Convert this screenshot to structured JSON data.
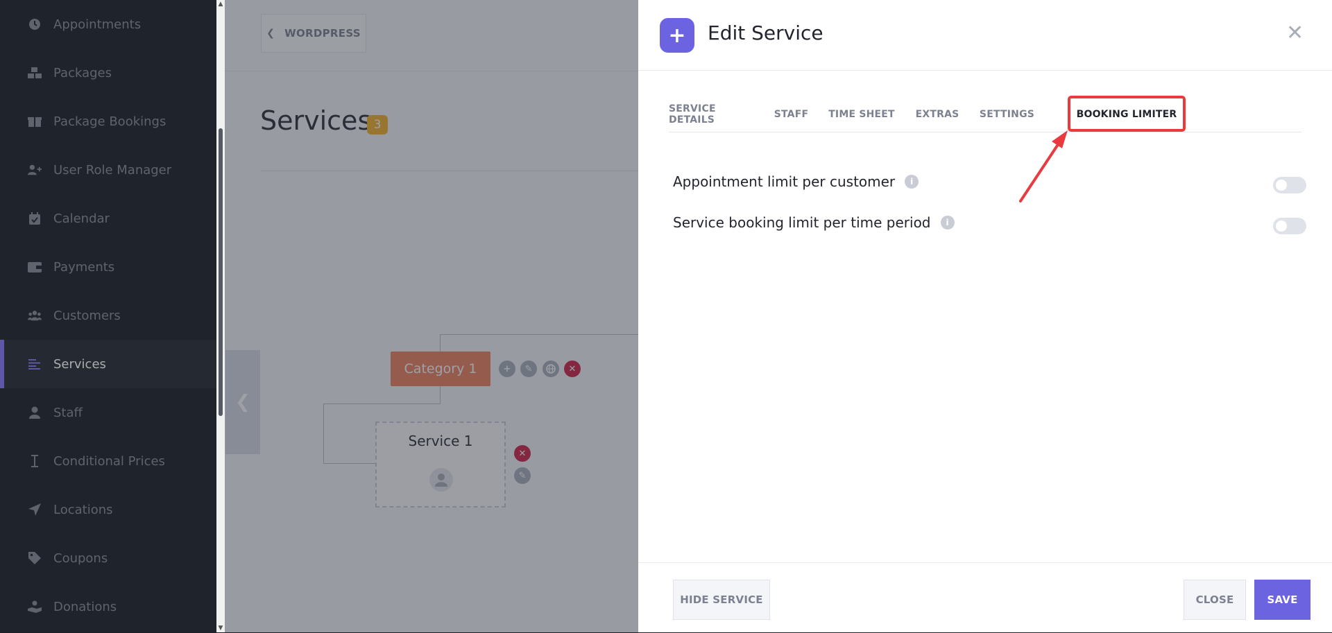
{
  "sidebar": {
    "items": [
      {
        "label": "Appointments",
        "icon": "clock-icon"
      },
      {
        "label": "Packages",
        "icon": "boxes-icon"
      },
      {
        "label": "Package Bookings",
        "icon": "gift-box-icon"
      },
      {
        "label": "User Role Manager",
        "icon": "user-plus-icon"
      },
      {
        "label": "Calendar",
        "icon": "calendar-icon"
      },
      {
        "label": "Payments",
        "icon": "wallet-icon"
      },
      {
        "label": "Customers",
        "icon": "users-icon"
      },
      {
        "label": "Services",
        "icon": "list-icon"
      },
      {
        "label": "Staff",
        "icon": "user-icon"
      },
      {
        "label": "Conditional Prices",
        "icon": "text-cursor-icon"
      },
      {
        "label": "Locations",
        "icon": "location-arrow-icon"
      },
      {
        "label": "Coupons",
        "icon": "tag-icon"
      },
      {
        "label": "Donations",
        "icon": "hand-holding-icon"
      }
    ],
    "active": "Services"
  },
  "page": {
    "back_label": "WORDPRESS",
    "title": "Services",
    "count": "3",
    "category_label": "Category 1",
    "service_label": "Service 1"
  },
  "modal": {
    "title": "Edit Service",
    "tabs": [
      {
        "label": "SERVICE DETAILS"
      },
      {
        "label": "STAFF"
      },
      {
        "label": "TIME SHEET"
      },
      {
        "label": "EXTRAS"
      },
      {
        "label": "SETTINGS"
      },
      {
        "label": "BOOKING LIMITER"
      }
    ],
    "active_tab": "BOOKING LIMITER",
    "options": [
      {
        "label": "Appointment limit per customer",
        "enabled": false
      },
      {
        "label": "Service booking limit per time period",
        "enabled": false
      }
    ],
    "footer": {
      "hide_label": "HIDE SERVICE",
      "close_label": "CLOSE",
      "save_label": "SAVE"
    }
  },
  "colors": {
    "accent": "#6c63e0",
    "highlight": "#ea3a3e",
    "category": "#ef8462",
    "badge": "#f4b22a",
    "danger": "#d0254a"
  }
}
